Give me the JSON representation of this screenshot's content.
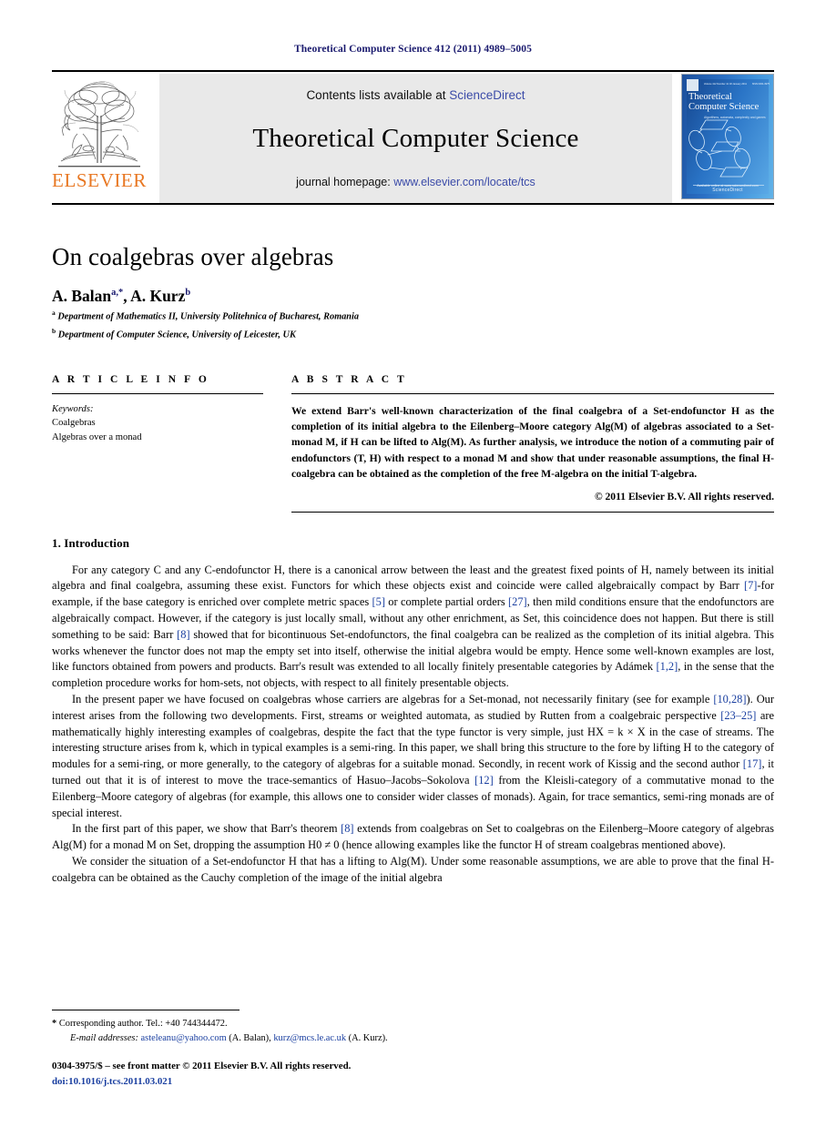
{
  "running_head": "Theoretical Computer Science 412 (2011) 4989–5005",
  "masthead": {
    "publisher_name": "ELSEVIER",
    "contents_prefix": "Contents lists available at ",
    "contents_link": "ScienceDirect",
    "journal_title": "Theoretical Computer Science",
    "homepage_prefix": "journal homepage: ",
    "homepage_link": "www.elsevier.com/locate/tcs",
    "cover": {
      "title_line1": "Theoretical",
      "title_line2": "Computer Science",
      "subtitle": "Algorithms, automata, complexity and games",
      "top_left_tiny": "Volume 412 Number 41  18 January 2011",
      "top_right_tiny": "ISSN 0304-3975",
      "footer_tiny": "Available online at www.sciencedirect.com",
      "footer_mark": "ScienceDirect"
    }
  },
  "article": {
    "title": "On coalgebras over algebras",
    "authors": [
      {
        "name": "A. Balan",
        "marks": "a,*"
      },
      {
        "name": "A. Kurz",
        "marks": "b"
      }
    ],
    "affiliations": [
      {
        "mark": "a",
        "text": "Department of Mathematics II, University Politehnica of Bucharest, Romania"
      },
      {
        "mark": "b",
        "text": "Department of Computer Science, University of Leicester, UK"
      }
    ]
  },
  "article_info": {
    "label": "A R T I C L E    I N F O",
    "keywords_label": "Keywords:",
    "keywords": [
      "Coalgebras",
      "Algebras over a monad"
    ]
  },
  "abstract": {
    "label": "A B S T R A C T",
    "text": "We extend Barr's well-known characterization of the final coalgebra of a Set-endofunctor H as the completion of its initial algebra to the Eilenberg–Moore category Alg(M) of algebras associated to a Set-monad M, if H can be lifted to Alg(M). As further analysis, we introduce the notion of a commuting pair of endofunctors (T, H) with respect to a monad M and show that under reasonable assumptions, the final H-coalgebra can be obtained as the completion of the free M-algebra on the initial T-algebra.",
    "copyright": "© 2011 Elsevier B.V. All rights reserved."
  },
  "introduction": {
    "heading": "1.  Introduction",
    "paragraphs": [
      "For any category C and any C-endofunctor H, there is a canonical arrow between the least and the greatest fixed points of H, namely between its initial algebra and final coalgebra, assuming these exist. Functors for which these objects exist and coincide were called algebraically compact by Barr [7]-for example, if the base category is enriched over complete metric spaces [5] or complete partial orders [27], then mild conditions ensure that the endofunctors are algebraically compact. However, if the category is just locally small, without any other enrichment, as Set, this coincidence does not happen. But there is still something to be said: Barr [8] showed that for bicontinuous Set-endofunctors, the final coalgebra can be realized as the completion of its initial algebra. This works whenever the functor does not map the empty set into itself, otherwise the initial algebra would be empty. Hence some well-known examples are lost, like functors obtained from powers and products. Barr's result was extended to all locally finitely presentable categories by Adámek [1,2], in the sense that the completion procedure works for hom-sets, not objects, with respect to all finitely presentable objects.",
      "In the present paper we have focused on coalgebras whose carriers are algebras for a Set-monad, not necessarily finitary (see for example [10,28]). Our interest arises from the following two developments. First, streams or weighted automata, as studied by Rutten from a coalgebraic perspective [23–25] are mathematically highly interesting examples of coalgebras, despite the fact that the type functor is very simple, just HX = k × X in the case of streams. The interesting structure arises from k, which in typical examples is a semi-ring. In this paper, we shall bring this structure to the fore by lifting H to the category of modules for a semi-ring, or more generally, to the category of algebras for a suitable monad. Secondly, in recent work of Kissig and the second author [17], it turned out that it is of interest to move the trace-semantics of Hasuo–Jacobs–Sokolova [12] from the Kleisli-category of a commutative monad to the Eilenberg–Moore category of algebras (for example, this allows one to consider wider classes of monads). Again, for trace semantics, semi-ring monads are of special interest.",
      "In the first part of this paper, we show that Barr's theorem [8] extends from coalgebras on Set to coalgebras on the Eilenberg–Moore category of algebras Alg(M) for a monad M on Set, dropping the assumption H0 ≠ 0 (hence allowing examples like the functor H of stream coalgebras mentioned above).",
      "We consider the situation of a Set-endofunctor H that has a lifting to Alg(M). Under some reasonable assumptions, we are able to prove that the final H-coalgebra can be obtained as the Cauchy completion of the image of the initial algebra"
    ]
  },
  "footnotes": {
    "corresponding": "Corresponding author. Tel.: +40 744344472.",
    "email_label": "E-mail addresses:",
    "emails": [
      {
        "address": "asteleanu@yahoo.com",
        "owner": "(A. Balan)"
      },
      {
        "address": "kurz@mcs.le.ac.uk",
        "owner": "(A. Kurz)"
      }
    ],
    "issn_line": "0304-3975/$ – see front matter © 2011 Elsevier B.V. All rights reserved.",
    "doi_line": "doi:10.1016/j.tcs.2011.03.021"
  },
  "colors": {
    "running_head": "#1a1a6e",
    "link_blue": "#3b4ba8",
    "reference_blue": "#1a3fa0",
    "elsevier_orange": "#E87722",
    "masthead_band": "#e9e9e9"
  }
}
